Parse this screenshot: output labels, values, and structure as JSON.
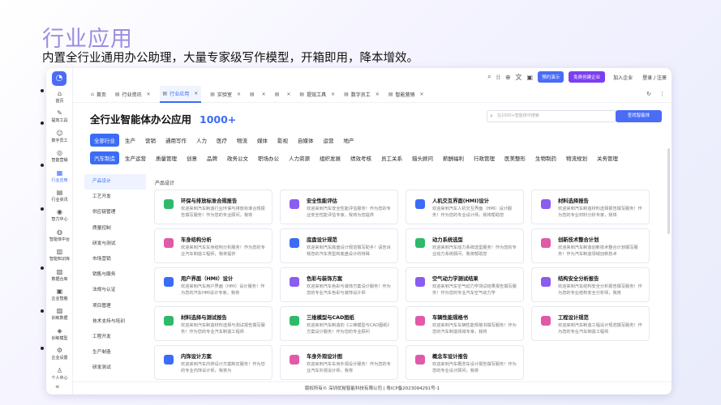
{
  "hero": {
    "title": "行业应用",
    "subtitle": "内置全行业通用办公助理，大量专家级写作模型，开箱即用，降本增效。"
  },
  "sidebar": {
    "logo_icon": "logo-icon",
    "items": [
      {
        "label": "首页",
        "icon": "home-icon"
      },
      {
        "label": "提效工具",
        "icon": "tool-icon"
      },
      {
        "label": "数字员工",
        "icon": "user-icon"
      },
      {
        "label": "智能营销",
        "icon": "marketing-icon"
      },
      {
        "label": "行业应用",
        "icon": "grid-icon",
        "active": true
      },
      {
        "label": "行业资讯",
        "icon": "news-icon"
      },
      {
        "label": "智力中心",
        "icon": "brain-icon"
      },
      {
        "label": "智能体中台",
        "icon": "agent-icon"
      },
      {
        "label": "智能知识库",
        "icon": "book-icon"
      },
      {
        "label": "数据合库",
        "icon": "database-icon"
      },
      {
        "label": "企业智脑",
        "icon": "chip-icon"
      },
      {
        "label": "训练数据",
        "icon": "data-icon"
      },
      {
        "label": "训练模型",
        "icon": "model-icon"
      },
      {
        "label": "企业设置",
        "icon": "settings-icon"
      },
      {
        "label": "个人中心",
        "icon": "person-icon"
      }
    ],
    "collapse_glyph": "«"
  },
  "topbar": {
    "demo_label": "预约演示",
    "enterprise_label": "免费创建企业",
    "join_label": "加入企业",
    "login_label": "登录 / 注册"
  },
  "tabs": [
    {
      "label": "首页",
      "closable": false
    },
    {
      "label": "行业资讯",
      "closable": true
    },
    {
      "label": "行业应用",
      "closable": true,
      "active": true
    },
    {
      "label": "实验室",
      "closable": true
    },
    {
      "label": "",
      "closable": true
    },
    {
      "label": "",
      "closable": true
    },
    {
      "label": "提效工具",
      "closable": true
    },
    {
      "label": "数字员工",
      "closable": true
    },
    {
      "label": "智能营销",
      "closable": true
    }
  ],
  "page": {
    "title": "全行业智能体办公应用",
    "count": "1000+",
    "search_placeholder": "在1000+智能体中搜索",
    "search_button": "查找智能体",
    "section_title": "产品设计"
  },
  "industries": [
    "全部行业",
    "生产",
    "营销",
    "通用写作",
    "人力",
    "医疗",
    "物流",
    "媒体",
    "影视",
    "自媒体",
    "运营",
    "地产"
  ],
  "industries_active": 0,
  "subcats": [
    "汽车制造",
    "生产运营",
    "质量管理",
    "创意",
    "品牌",
    "政务公文",
    "职场办公",
    "人力资源",
    "组织发展",
    "绩效考核",
    "员工关系",
    "猎头顾问",
    "薪酬福利",
    "行政管理",
    "医美整形",
    "生物制药",
    "物流规划",
    "关务管理"
  ],
  "subcats_active": 0,
  "categories": [
    "产品设计",
    "工艺开发",
    "供应链管理",
    "质量控制",
    "研发与测试",
    "市场营销",
    "销售与服务",
    "法规与认证",
    "项目管理",
    "技术支持与培训",
    "工程开发",
    "生产制造",
    "研发测试"
  ],
  "categories_active": 0,
  "cards": [
    {
      "title": "环保与排放标准合规报告",
      "desc": "欢迎来到汽车制造行业环保与排放标准合规报告撰写服务！作为您的专业顾问，我将",
      "color": "#2fb96b"
    },
    {
      "title": "安全性能评估",
      "desc": "欢迎来到汽车安全性能评估服务！作为您的专业安全性能评估专家，我将为您提供",
      "color": "#8a5cf0"
    },
    {
      "title": "人机交互界面(HMI)设计",
      "desc": "欢迎来到汽车人机交互界面（HMI）设计服务！作为您的专业设计师，我将帮助您",
      "color": "#3b6cf6"
    },
    {
      "title": "材料选择报告",
      "desc": "欢迎来到汽车制造材料选择报告撰写服务！作为您的专业材料分析专家，我将",
      "color": "#8a5cf0"
    },
    {
      "title": "车身结构分析",
      "desc": "欢迎来到汽车车身结构分析服务！作为您的专业汽车制造工程师，我将提供",
      "color": "#e05aa8"
    },
    {
      "title": "底盘设计规范",
      "desc": "欢迎来到汽车底盘设计规范撰写助手！请告诉我您的汽车类型和底盘设计的特殊",
      "color": "#3b6cf6"
    },
    {
      "title": "动力系统选型",
      "desc": "欢迎来到汽车动力系统选型服务！作为您的专业动力系统顾问，我将帮助您",
      "color": "#2fb96b"
    },
    {
      "title": "创新技术整合计划",
      "desc": "欢迎来到汽车制造创新技术整合计划撰写服务！作为汽车制造领域创新技术",
      "color": "#e05aa8"
    },
    {
      "title": "用户界面（HMI）设计",
      "desc": "欢迎来到汽车用户界面（HMI）设计服务！作为您的汽车HMI设计专家，我将",
      "color": "#3b6cf6"
    },
    {
      "title": "色彩与装饰方案",
      "desc": "欢迎来到汽车色彩与装饰方案设计服务！作为您的专业汽车色彩与装饰设计师",
      "color": "#8a5cf0"
    },
    {
      "title": "空气动力学测试结果",
      "desc": "欢迎来到汽车空气动力学测试结果报告撰写服务！作为您的专业汽车空气动力学",
      "color": "#8a5cf0"
    },
    {
      "title": "结构安全分析报告",
      "desc": "欢迎来到汽车结构安全分析报告撰写服务！作为您的专业结构安全分析师，我将",
      "color": "#8a5cf0"
    },
    {
      "title": "材料选择与测试报告",
      "desc": "欢迎来到汽车制造材料选择与测试报告撰写服务！作为您的专业汽车制造工程师",
      "color": "#2fb96b"
    },
    {
      "title": "三维模型与CAD图纸",
      "desc": "欢迎来到汽车制造的《三维模型与CAD图纸》方案设计服务！作为您的专业顾问",
      "color": "#2fb96b"
    },
    {
      "title": "车辆性能规格书",
      "desc": "欢迎来到汽车车辆性能规格书撰写服务！作为您的汽车制造领域专家，我将",
      "color": "#e05aa8"
    },
    {
      "title": "工程设计规范",
      "desc": "欢迎来到汽车制造工程设计规范撰写服务！作为您的专业汽车制造工程师",
      "color": "#e05aa8"
    },
    {
      "title": "内饰设计方案",
      "desc": "欢迎来到汽车内饰设计方案制定服务！作为您的专业内饰设计师，我将为",
      "color": "#3b6cf6"
    },
    {
      "title": "车身外观设计图",
      "desc": "欢迎来到汽车车身外观设计服务！作为您的专业汽车外观设计师，我将",
      "color": "#e05aa8"
    },
    {
      "title": "概念车设计报告",
      "desc": "欢迎来到汽车概念车设计报告撰写服务！作为您的专业设计顾问，我将",
      "color": "#e05aa8"
    }
  ],
  "footer": "版权所有© 深圳优秘智能科技有限公司 | 粤ICP备2023094291号-1"
}
